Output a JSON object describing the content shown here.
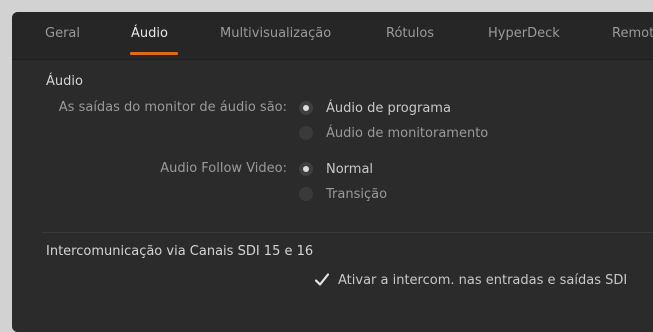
{
  "tabs": [
    {
      "label": "Geral"
    },
    {
      "label": "Áudio"
    },
    {
      "label": "Multivisualização"
    },
    {
      "label": "Rótulos"
    },
    {
      "label": "HyperDeck"
    },
    {
      "label": "Remot"
    }
  ],
  "active_tab": "Áudio",
  "accent_color": "#e06a1c",
  "audio_section": {
    "title": "Áudio",
    "monitor_output": {
      "label": "As saídas do monitor de áudio são:",
      "options": [
        {
          "label": "Áudio de programa",
          "selected": true
        },
        {
          "label": "Áudio de monitoramento",
          "selected": false
        }
      ]
    },
    "follow_video": {
      "label": "Audio Follow Video:",
      "options": [
        {
          "label": "Normal",
          "selected": true
        },
        {
          "label": "Transição",
          "selected": false
        }
      ]
    }
  },
  "intercom_section": {
    "title": "Intercomunicação via Canais SDI 15 e 16",
    "checkbox": {
      "label": "Ativar a intercom. nas entradas e saídas SDI",
      "checked": true
    }
  },
  "icons": {
    "radio_selected": "radio-selected-icon",
    "radio_unselected": "radio-unselected-icon",
    "checkmark": "checkmark-icon"
  }
}
